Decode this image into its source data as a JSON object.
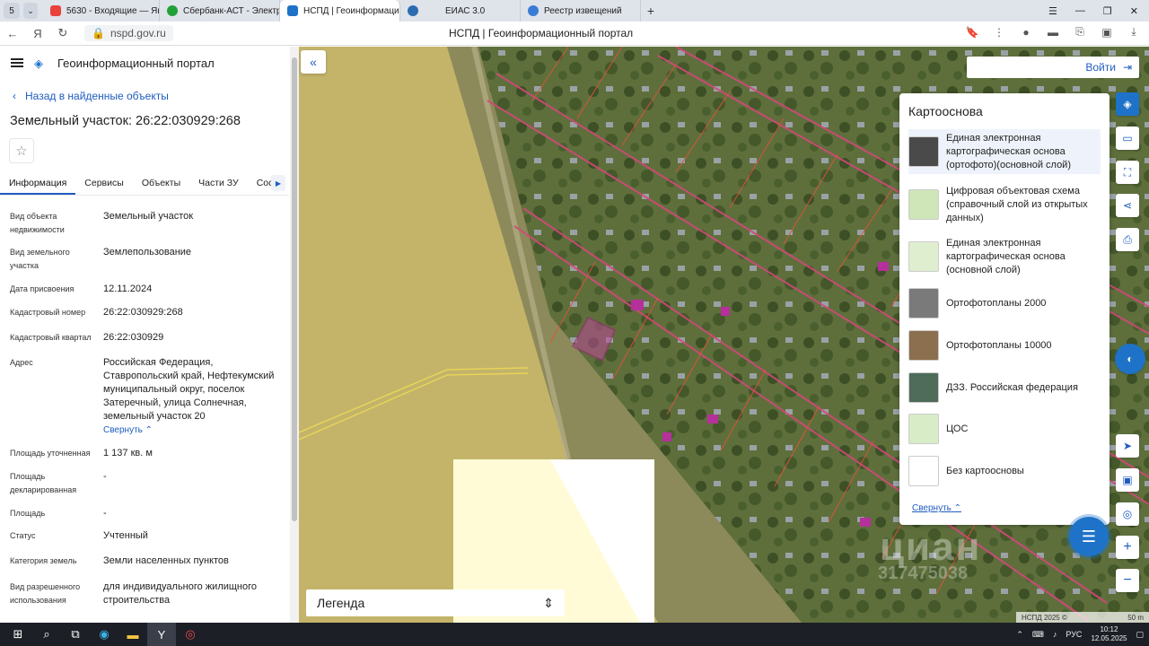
{
  "browser": {
    "tab_count": "5",
    "tabs": [
      {
        "label": "5630 - Входящие — Янде",
        "color": "#e8423b"
      },
      {
        "label": "Сбербанк-АСТ - Электро",
        "color": "#21a038"
      },
      {
        "label": "НСПД | Геоинформаци",
        "color": "#1e73c8",
        "active": true
      },
      {
        "label": "ЕИАС 3.0",
        "color": "#2b6cb0"
      },
      {
        "label": "Реестр извещений",
        "color": "#3a7bd5"
      }
    ],
    "url": "nspd.gov.ru",
    "page_title": "НСПД | Геоинформационный портал"
  },
  "app": {
    "title": "Геоинформационный портал",
    "back_label": "Назад в найденные объекты",
    "object_title": "Земельный участок: 26:22:030929:268",
    "tabs": [
      "Информация",
      "Сервисы",
      "Объекты",
      "Части ЗУ",
      "Соста"
    ],
    "collapse_label": "Свернуть",
    "properties": [
      {
        "key": "Вид объекта недвижимости",
        "value": "Земельный участок"
      },
      {
        "key": "Вид земельного участка",
        "value": "Землепользование"
      },
      {
        "key": "Дата присвоения",
        "value": "12.11.2024"
      },
      {
        "key": "Кадастровый номер",
        "value": "26:22:030929:268"
      },
      {
        "key": "Кадастровый квартал",
        "value": "26:22:030929"
      },
      {
        "key": "Адрес",
        "value": "Российская Федерация, Ставропольский край, Нефтекумский муниципальный округ, поселок Затеречный, улица Солнечная, земельный участок 20"
      },
      {
        "key": "Площадь уточненная",
        "value": "1 137 кв. м"
      },
      {
        "key": "Площадь декларированная",
        "value": "-"
      },
      {
        "key": "Площадь",
        "value": "-"
      },
      {
        "key": "Статус",
        "value": "Учтенный"
      },
      {
        "key": "Категория земель",
        "value": "Земли населенных пунктов"
      },
      {
        "key": "Вид разрешенного использования",
        "value": "для индивидуального жилищного строительства"
      }
    ]
  },
  "map": {
    "login_label": "Войти",
    "basemap": {
      "title": "Картооснова",
      "items": [
        {
          "label": "Единая электронная картографическая основа (ортофото)(основной слой)",
          "thumb": "#4a4a4a",
          "selected": true
        },
        {
          "label": "Цифровая объектовая схема (справочный слой из открытых данных)",
          "thumb": "#cfe6b8"
        },
        {
          "label": "Единая электронная картографическая основа (основной слой)",
          "thumb": "#dfeecf"
        },
        {
          "label": "Ортофотопланы 2000",
          "thumb": "#7a7a7a"
        },
        {
          "label": "Ортофотопланы 10000",
          "thumb": "#8b6f4e"
        },
        {
          "label": "ДЗЗ. Российская федерация",
          "thumb": "#4f6b5a"
        },
        {
          "label": "ЦОС",
          "thumb": "#d8ecc8"
        },
        {
          "label": "Без картоосновы",
          "thumb": "#ffffff"
        }
      ],
      "collapse_label": "Свернуть"
    },
    "legend_label": "Легенда",
    "attribution": "НСПД 2025 ©",
    "scale": "50 m",
    "watermark": "циан",
    "watermark_id": "317475038"
  },
  "taskbar": {
    "lang": "РУС",
    "time": "10:12",
    "date": "12.05.2025"
  }
}
